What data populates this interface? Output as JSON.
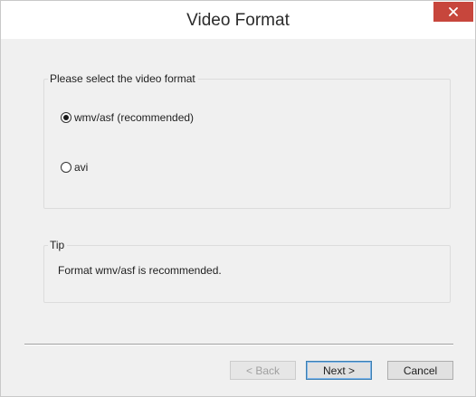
{
  "window": {
    "title": "Video Format",
    "close_icon": "close-icon"
  },
  "format_group": {
    "legend": "Please select the video format",
    "options": [
      {
        "label": "wmv/asf (recommended)",
        "selected": true
      },
      {
        "label": "avi",
        "selected": false
      }
    ]
  },
  "tip_group": {
    "legend": "Tip",
    "text": "Format wmv/asf is recommended."
  },
  "buttons": {
    "back": {
      "label": "< Back",
      "enabled": false
    },
    "next": {
      "label": "Next >",
      "enabled": true,
      "default": true
    },
    "cancel": {
      "label": "Cancel",
      "enabled": true
    }
  },
  "colors": {
    "close_button": "#c7463c",
    "dialog_background": "#f0f0f0",
    "default_button_border": "#3c7fb1"
  }
}
